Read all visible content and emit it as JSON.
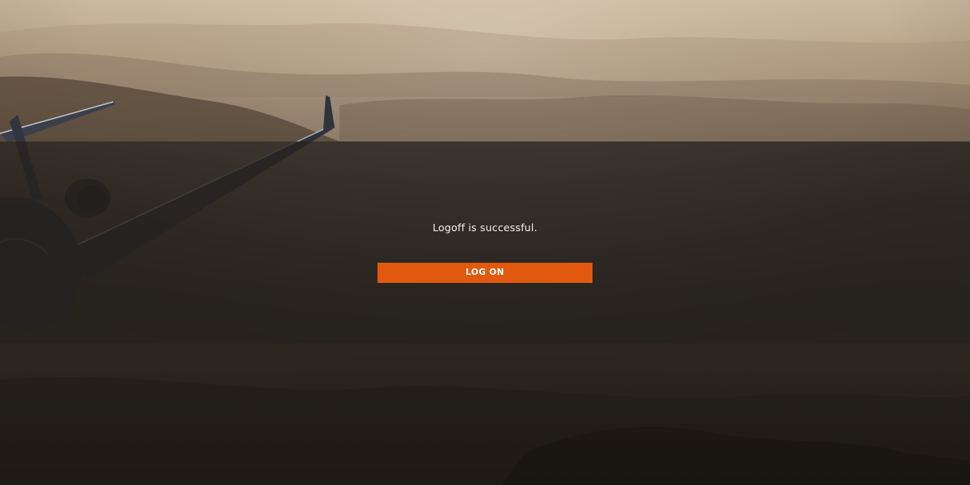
{
  "message": {
    "text": "Logoff is successful."
  },
  "actions": {
    "logon_label": "LOG ON"
  },
  "colors": {
    "accent": "#e0590f",
    "overlay": "#26221e",
    "message_text": "#f2f2f2"
  }
}
